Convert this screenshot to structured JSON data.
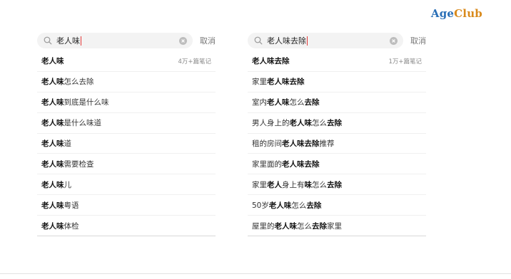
{
  "brand": {
    "part1": "Age",
    "part2": "Club"
  },
  "left": {
    "query": "老人味",
    "cancel": "取消",
    "items": [
      {
        "bold": "老人味",
        "rest": "",
        "count": "4万+篇笔记"
      },
      {
        "bold": "老人味",
        "rest": "怎么去除"
      },
      {
        "bold": "老人味",
        "rest": "到底是什么味"
      },
      {
        "bold": "老人味",
        "rest": "是什么味道"
      },
      {
        "bold": "老人味",
        "rest": "道"
      },
      {
        "bold": "老人味",
        "rest": "需要检查"
      },
      {
        "bold": "老人味",
        "rest": "儿"
      },
      {
        "bold": "老人味",
        "rest": "粤语"
      },
      {
        "bold": "老人味",
        "rest": "体检"
      }
    ]
  },
  "right": {
    "query": "老人味去除",
    "cancel": "取消",
    "items": [
      {
        "parts": [
          {
            "t": "老人味去除",
            "b": true
          }
        ],
        "count": "1万+篇笔记"
      },
      {
        "parts": [
          {
            "t": "家里",
            "b": false
          },
          {
            "t": "老人味去除",
            "b": true
          }
        ]
      },
      {
        "parts": [
          {
            "t": "室内",
            "b": false
          },
          {
            "t": "老人味",
            "b": true
          },
          {
            "t": "怎么",
            "b": false
          },
          {
            "t": "去除",
            "b": true
          }
        ]
      },
      {
        "parts": [
          {
            "t": "男人身上的",
            "b": false
          },
          {
            "t": "老人味",
            "b": true
          },
          {
            "t": "怎么",
            "b": false
          },
          {
            "t": "去除",
            "b": true
          }
        ]
      },
      {
        "parts": [
          {
            "t": "租的房间",
            "b": false
          },
          {
            "t": "老人味去除",
            "b": true
          },
          {
            "t": "推荐",
            "b": false
          }
        ]
      },
      {
        "parts": [
          {
            "t": "家里面的",
            "b": false
          },
          {
            "t": "老人味去除",
            "b": true
          }
        ]
      },
      {
        "parts": [
          {
            "t": "家里",
            "b": false
          },
          {
            "t": "老人",
            "b": true
          },
          {
            "t": "身上有",
            "b": false
          },
          {
            "t": "味",
            "b": true
          },
          {
            "t": "怎么",
            "b": false
          },
          {
            "t": "去除",
            "b": true
          }
        ]
      },
      {
        "parts": [
          {
            "t": "50岁",
            "b": false
          },
          {
            "t": "老人味",
            "b": true
          },
          {
            "t": "怎么",
            "b": false
          },
          {
            "t": "去除",
            "b": true
          }
        ]
      },
      {
        "parts": [
          {
            "t": "屋里的",
            "b": false
          },
          {
            "t": "老人味",
            "b": true
          },
          {
            "t": "怎么",
            "b": false
          },
          {
            "t": "去除",
            "b": true
          },
          {
            "t": "家里",
            "b": false
          }
        ]
      }
    ]
  }
}
